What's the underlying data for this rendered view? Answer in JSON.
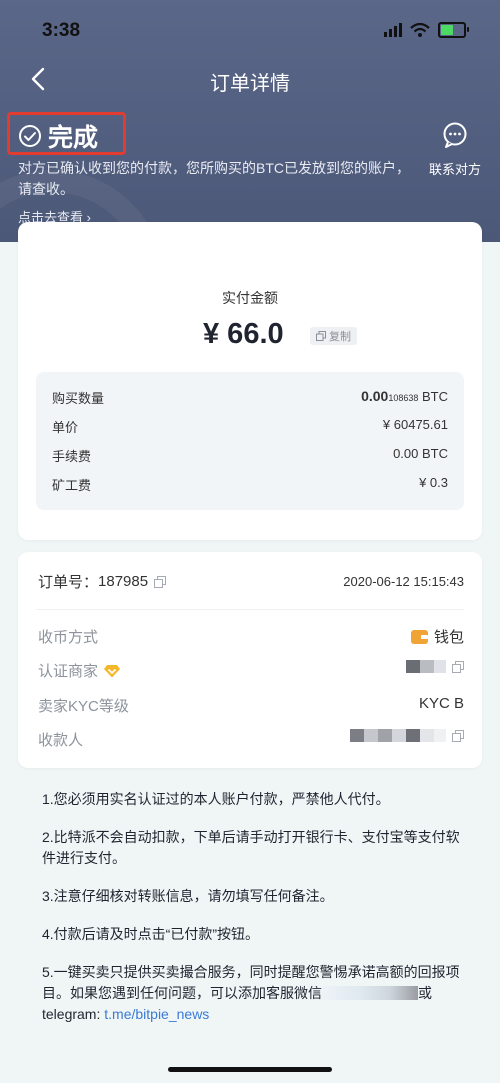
{
  "status_bar": {
    "time": "3:38"
  },
  "nav": {
    "title": "订单详情",
    "back_icon": "chevron-left-icon"
  },
  "status": {
    "label": "完成",
    "icon": "check-circle-icon",
    "description": "对方已确认收到您的付款，您所购买的BTC已发放到您的账户，请查收。",
    "link": "点击去查看 ›"
  },
  "contact": {
    "label": "联系对方",
    "icon": "chat-bubble-icon"
  },
  "payment": {
    "amount_label": "实付金额",
    "amount": "¥ 66.0",
    "copy_label": "复制",
    "rows": [
      {
        "key": "购买数量",
        "value_main": "0.00",
        "value_small": "108638",
        "value_unit": " BTC"
      },
      {
        "key": "单价",
        "value": "¥ 60475.61"
      },
      {
        "key": "手续费",
        "value": "0.00 BTC"
      },
      {
        "key": "矿工费",
        "value": "¥ 0.3"
      }
    ]
  },
  "order": {
    "number_label": "订单号：",
    "number": "187985",
    "time": "2020-06-12 15:15:43",
    "rows": [
      {
        "key": "收币方式",
        "value": "钱包"
      },
      {
        "key": "认证商家",
        "value": ""
      },
      {
        "key": "卖家KYC等级",
        "value": "KYC B"
      },
      {
        "key": "收款人",
        "value": ""
      }
    ]
  },
  "notes": [
    "1.您必须用实名认证过的本人账户付款，严禁他人代付。",
    "2.比特派不会自动扣款，下单后请手动打开银行卡、支付宝等支付软件进行支付。",
    "3.注意仔细核对转账信息，请勿填写任何备注。",
    "4.付款后请及时点击“已付款”按钮。",
    "5.一键买卖只提供买卖撮合服务，同时提醒您警惕承诺高额的回报项目。如果您遇到任何问题，可以添加客服微信"
  ],
  "notes_tail": {
    "or": "或",
    "telegram_label": "telegram: ",
    "telegram_link": "t.me/bitpie_news"
  },
  "colors": {
    "header": "#55627f",
    "highlight": "#e23b30",
    "link": "#3a7bd5",
    "wallet": "#f0a436"
  }
}
